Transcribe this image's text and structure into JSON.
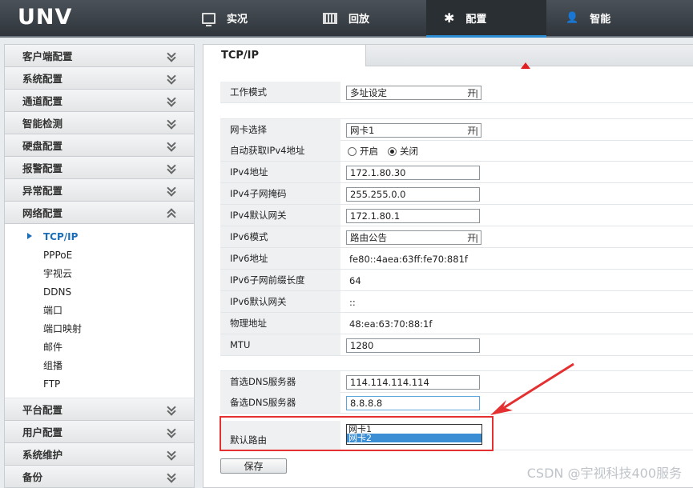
{
  "logo": "UNV",
  "nav": [
    {
      "label": "实况",
      "icon": "monitor-icon"
    },
    {
      "label": "回放",
      "icon": "film-icon"
    },
    {
      "label": "配置",
      "icon": "gear-icon",
      "active": true
    },
    {
      "label": "智能",
      "icon": "person-icon"
    }
  ],
  "sidebar": {
    "sections_top": [
      "客户端配置",
      "系统配置",
      "通道配置",
      "智能检测",
      "硬盘配置",
      "报警配置",
      "异常配置"
    ],
    "network": {
      "label": "网络配置",
      "items": [
        "TCP/IP",
        "PPPoE",
        "宇视云",
        "DDNS",
        "端口",
        "端口映射",
        "邮件",
        "组播",
        "FTP"
      ],
      "active_item": "TCP/IP"
    },
    "sections_bottom": [
      "平台配置",
      "用户配置",
      "系统维护",
      "备份"
    ]
  },
  "tab": {
    "title": "TCP/IP"
  },
  "form": {
    "work_mode": {
      "label": "工作模式",
      "value": "多址设定"
    },
    "nic_select": {
      "label": "网卡选择",
      "value": "网卡1"
    },
    "dhcp": {
      "label": "自动获取IPv4地址",
      "on_label": "开启",
      "off_label": "关闭",
      "selected": "关闭"
    },
    "ipv4_addr": {
      "label": "IPv4地址",
      "value": "172.1.80.30"
    },
    "ipv4_mask": {
      "label": "IPv4子网掩码",
      "value": "255.255.0.0"
    },
    "ipv4_gw": {
      "label": "IPv4默认网关",
      "value": "172.1.80.1"
    },
    "ipv6_mode": {
      "label": "IPv6模式",
      "value": "路由公告"
    },
    "ipv6_addr": {
      "label": "IPv6地址",
      "value": "fe80::4aea:63ff:fe70:881f"
    },
    "ipv6_prefix": {
      "label": "IPv6子网前缀长度",
      "value": "64"
    },
    "ipv6_gw": {
      "label": "IPv6默认网关",
      "value": "::"
    },
    "mac": {
      "label": "物理地址",
      "value": "48:ea:63:70:88:1f"
    },
    "mtu": {
      "label": "MTU",
      "value": "1280"
    },
    "dns_primary": {
      "label": "首选DNS服务器",
      "value": "114.114.114.114"
    },
    "dns_secondary": {
      "label": "备选DNS服务器",
      "value": "8.8.8.8"
    },
    "default_route": {
      "label": "默认路由",
      "options": [
        "网卡1",
        "网卡2"
      ],
      "highlighted": "网卡2"
    }
  },
  "select_arrow_glyph": "开|",
  "save_label": "保存",
  "watermark": "CSDN @宇视科技400服务",
  "annotation_color": "#e43030"
}
